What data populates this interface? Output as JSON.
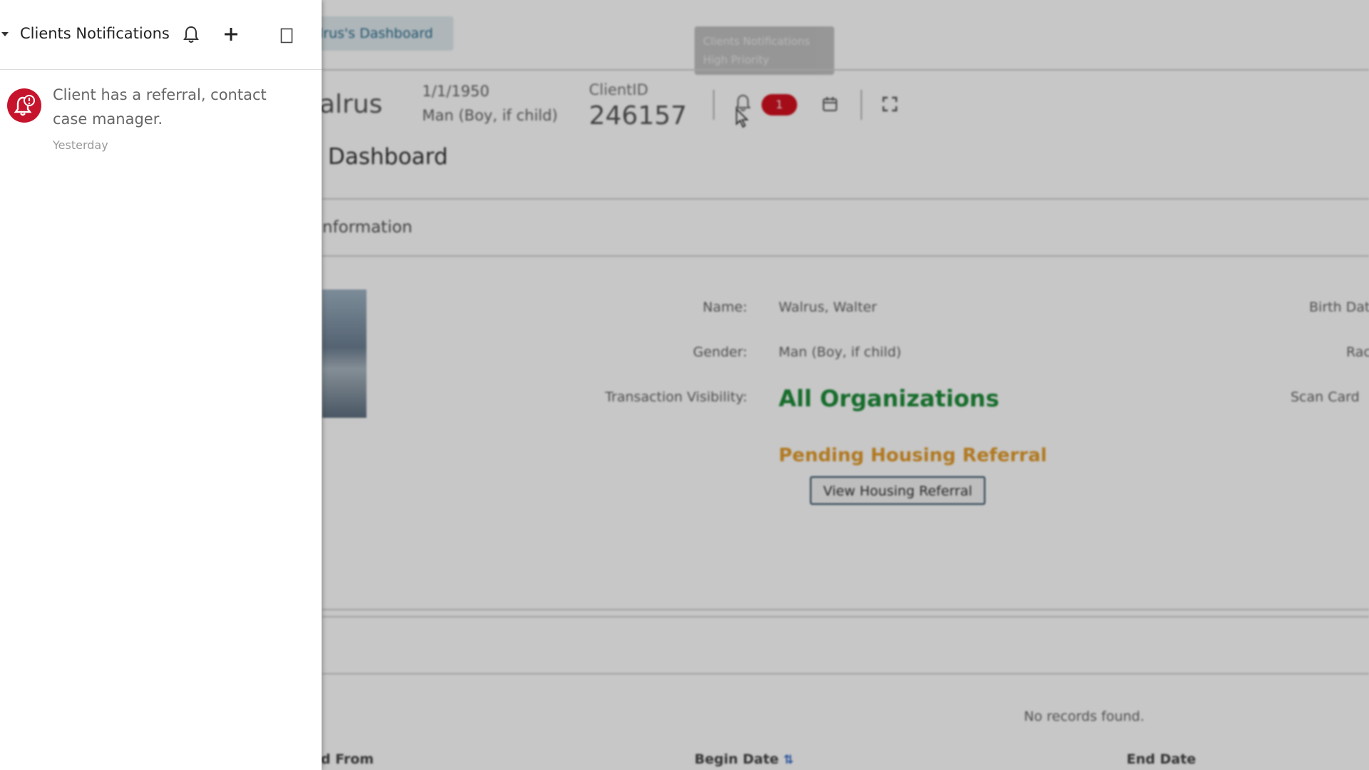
{
  "panel": {
    "title": "Clients Notifications",
    "icons": [
      "caret-down-icon",
      "bell-icon",
      "plus-icon",
      "square-icon"
    ],
    "notifications": [
      {
        "icon": "bell-alert-icon",
        "text": "Client has a referral, contact case manager.",
        "time": "Yesterday"
      }
    ]
  },
  "dashboard": {
    "breadcrumb": "lrus's Dashboard",
    "tooltip": "Clients Notifications High Priority",
    "client_name_partial": "alrus",
    "dob": "1/1/1950",
    "gender_short": "Man (Boy, if child)",
    "client_id_label": "ClientID",
    "client_id": "246157",
    "notification_badge": "1",
    "title": "Dashboard",
    "section_information": "nformation",
    "fields": {
      "name_label": "Name:",
      "name_value": "Walrus, Walter",
      "gender_label": "Gender:",
      "gender_value": "Man (Boy, if child)",
      "visibility_label": "Transaction Visibility:",
      "visibility_value": "All Organizations",
      "birth_label": "Birth Dat",
      "race_label": "Rac",
      "scan_label": "Scan Card"
    },
    "pending_referral": "Pending Housing Referral",
    "view_referral_button": "View Housing Referral",
    "no_records": "No records found.",
    "table_headers": {
      "from": "d From",
      "begin": "Begin Date",
      "end": "End Date"
    }
  },
  "colors": {
    "alert_red": "#c6142c",
    "badge_red": "#d3101f",
    "visibility_green": "#1d8b38",
    "pending_orange": "#e39b2a"
  }
}
